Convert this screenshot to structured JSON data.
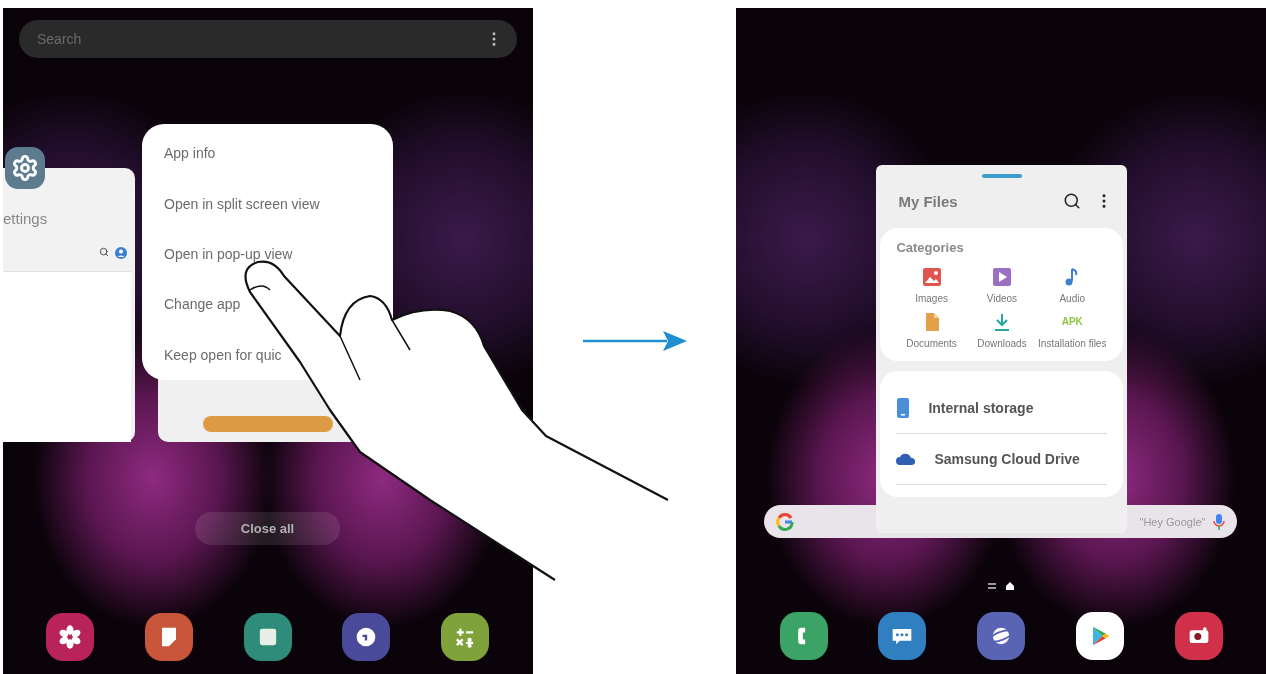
{
  "left_screen": {
    "search": {
      "placeholder": "Search"
    },
    "settings_card": {
      "title": "ettings"
    },
    "context_menu": {
      "items": [
        {
          "label": "App info"
        },
        {
          "label": "Open in split screen view"
        },
        {
          "label": "Open in pop-up view"
        },
        {
          "label": "Change app"
        },
        {
          "label": "Keep open for quic"
        }
      ]
    },
    "close_all_button": "Close all"
  },
  "right_screen": {
    "popup_window": {
      "title": "My Files",
      "categories": {
        "title": "Categories",
        "items": [
          {
            "kind": "images",
            "label": "Images"
          },
          {
            "kind": "videos",
            "label": "Videos"
          },
          {
            "kind": "audio",
            "label": "Audio"
          },
          {
            "kind": "documents",
            "label": "Documents"
          },
          {
            "kind": "downloads",
            "label": "Downloads"
          },
          {
            "kind": "apk",
            "label": "Installation files",
            "icon_text": "APK"
          }
        ]
      },
      "storage": [
        {
          "kind": "phone",
          "label": "Internal storage"
        },
        {
          "kind": "cloud",
          "label": "Samsung Cloud Drive"
        }
      ]
    },
    "google_bar": {
      "placeholder": "\"Hey Google\""
    }
  }
}
